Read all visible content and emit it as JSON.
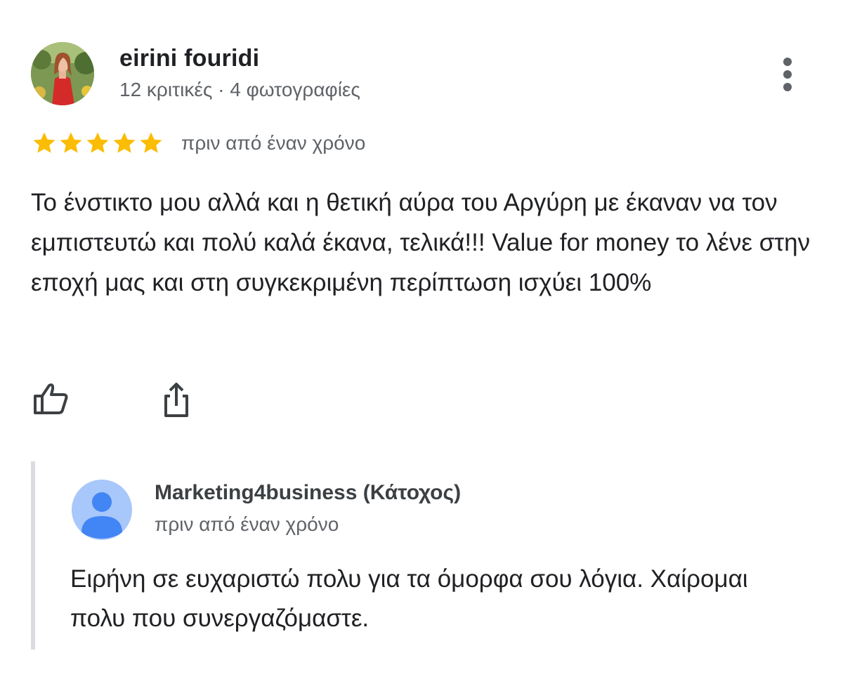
{
  "review": {
    "author": {
      "name": "eirini fouridi",
      "meta": "12 κριτικές · 4 φωτογραφίες"
    },
    "rating": 5,
    "date": "πριν από έναν χρόνο",
    "text": "Το ένστικτο μου αλλά και η θετική αύρα του Αργύρη με έκαναν να τον εμπιστευτώ και πολύ καλά έκανα, τελικά!!! Value for money το λένε στην εποχή μας και στη συγκεκριμένη περίπτωση ισχύει 100%",
    "actions": {
      "like_icon": "thumb-up-icon",
      "share_icon": "share-icon",
      "more_icon": "more-vert-icon"
    }
  },
  "owner_reply": {
    "name": "Marketing4business (Κάτοχος)",
    "date": "πριν από έναν χρόνο",
    "text": "Ειρήνη σε ευχαριστώ πολυ για τα όμορφα σου λόγια. Χαίρομαι πολυ που συνεργαζόμαστε."
  },
  "colors": {
    "star": "#fbbc04",
    "secondary_text": "#5f6368",
    "reply_border": "#dadce0",
    "owner_avatar_bg": "#a8c7fa",
    "owner_avatar_fg": "#4285f4"
  }
}
